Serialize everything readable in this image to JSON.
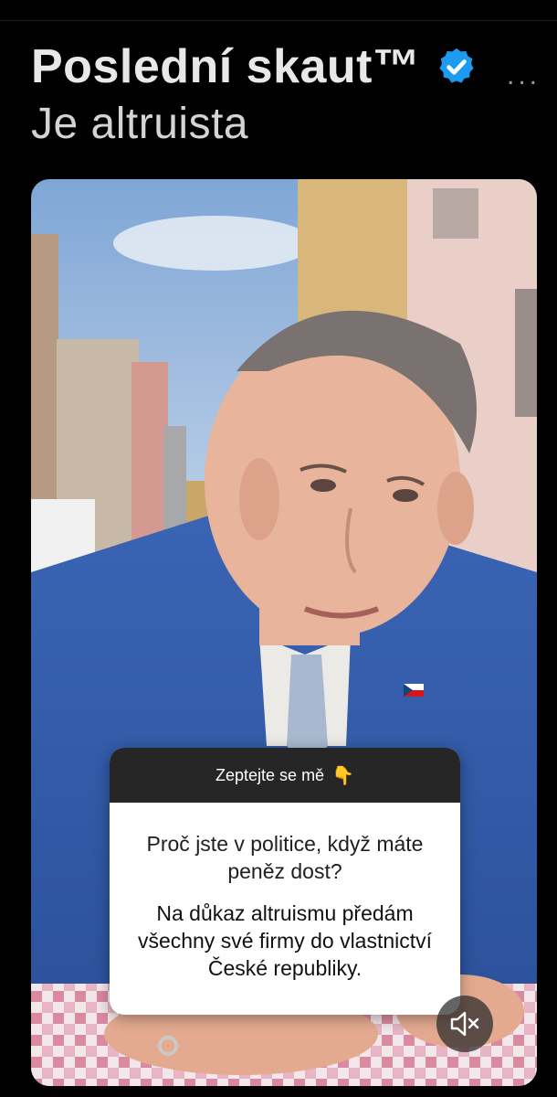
{
  "header": {
    "title": "Poslední skaut™",
    "subtitle": "Je altruista",
    "verified_icon": "verified-badge-icon",
    "more_icon": "more-dots-icon",
    "more_label": "..."
  },
  "story": {
    "question_box": {
      "prompt": "Zeptejte se mě",
      "prompt_emoji": "👇",
      "question": "Proč jste v politice, když máte peněz dost?",
      "answer": "Na důkaz altruismu předám všechny své firmy do vlastnictví České republiky."
    },
    "mute_icon": "speaker-muted-icon"
  },
  "colors": {
    "background": "#000000",
    "verified_blue": "#1d9bf0",
    "question_header": "#262626"
  }
}
